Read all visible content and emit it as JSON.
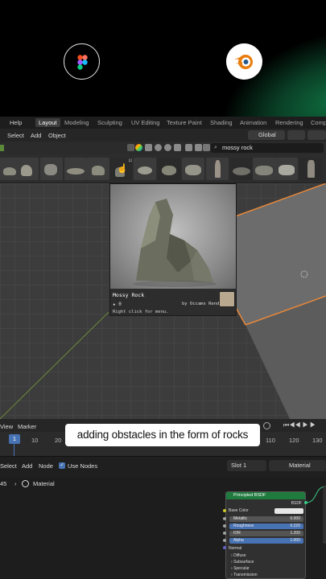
{
  "intro": {
    "left_icon": "figma-icon",
    "right_icon": "blender-icon"
  },
  "topbar": {
    "help": "Help",
    "tabs": [
      "Layout",
      "Modeling",
      "Sculpting",
      "UV Editing",
      "Texture Paint",
      "Shading",
      "Animation",
      "Rendering",
      "Comp"
    ]
  },
  "menubar": {
    "items": [
      "Select",
      "Add",
      "Object"
    ],
    "orientation": "Global"
  },
  "asset_browser": {
    "search_value": "mossy rock"
  },
  "preview": {
    "title": "Mossy Rock",
    "star_count": "0",
    "author": "by Occams Render",
    "hint": "Right click for menu."
  },
  "timeline": {
    "view": "View",
    "marker": "Marker",
    "current_frame": "1",
    "ticks": [
      "10",
      "20",
      "110",
      "120",
      "130"
    ]
  },
  "caption": "adding obstacles in the form of rocks",
  "node_editor": {
    "menu": [
      "Select",
      "Add",
      "Node"
    ],
    "use_nodes": "Use Nodes",
    "slot": "Slot 1",
    "material_name": "Material",
    "breadcrumb_prefix": "45",
    "breadcrumb_item": "Material"
  },
  "bsdf": {
    "title": "Principled BSDF",
    "output": "BSDF",
    "base_color": "Base Color",
    "metallic": {
      "label": "Metallic",
      "value": "0.000"
    },
    "roughness": {
      "label": "Roughness",
      "value": "0.220"
    },
    "ior": {
      "label": "IOR",
      "value": "1.200"
    },
    "alpha": {
      "label": "Alpha",
      "value": "1.000"
    },
    "normal": "Normal",
    "sections": [
      "Diffuse",
      "Subsurface",
      "Specular",
      "Transmission"
    ]
  },
  "colors": {
    "accent": "#4772b3",
    "bsdf_header": "#1f7a3d",
    "selection_orange": "#e8883a"
  }
}
